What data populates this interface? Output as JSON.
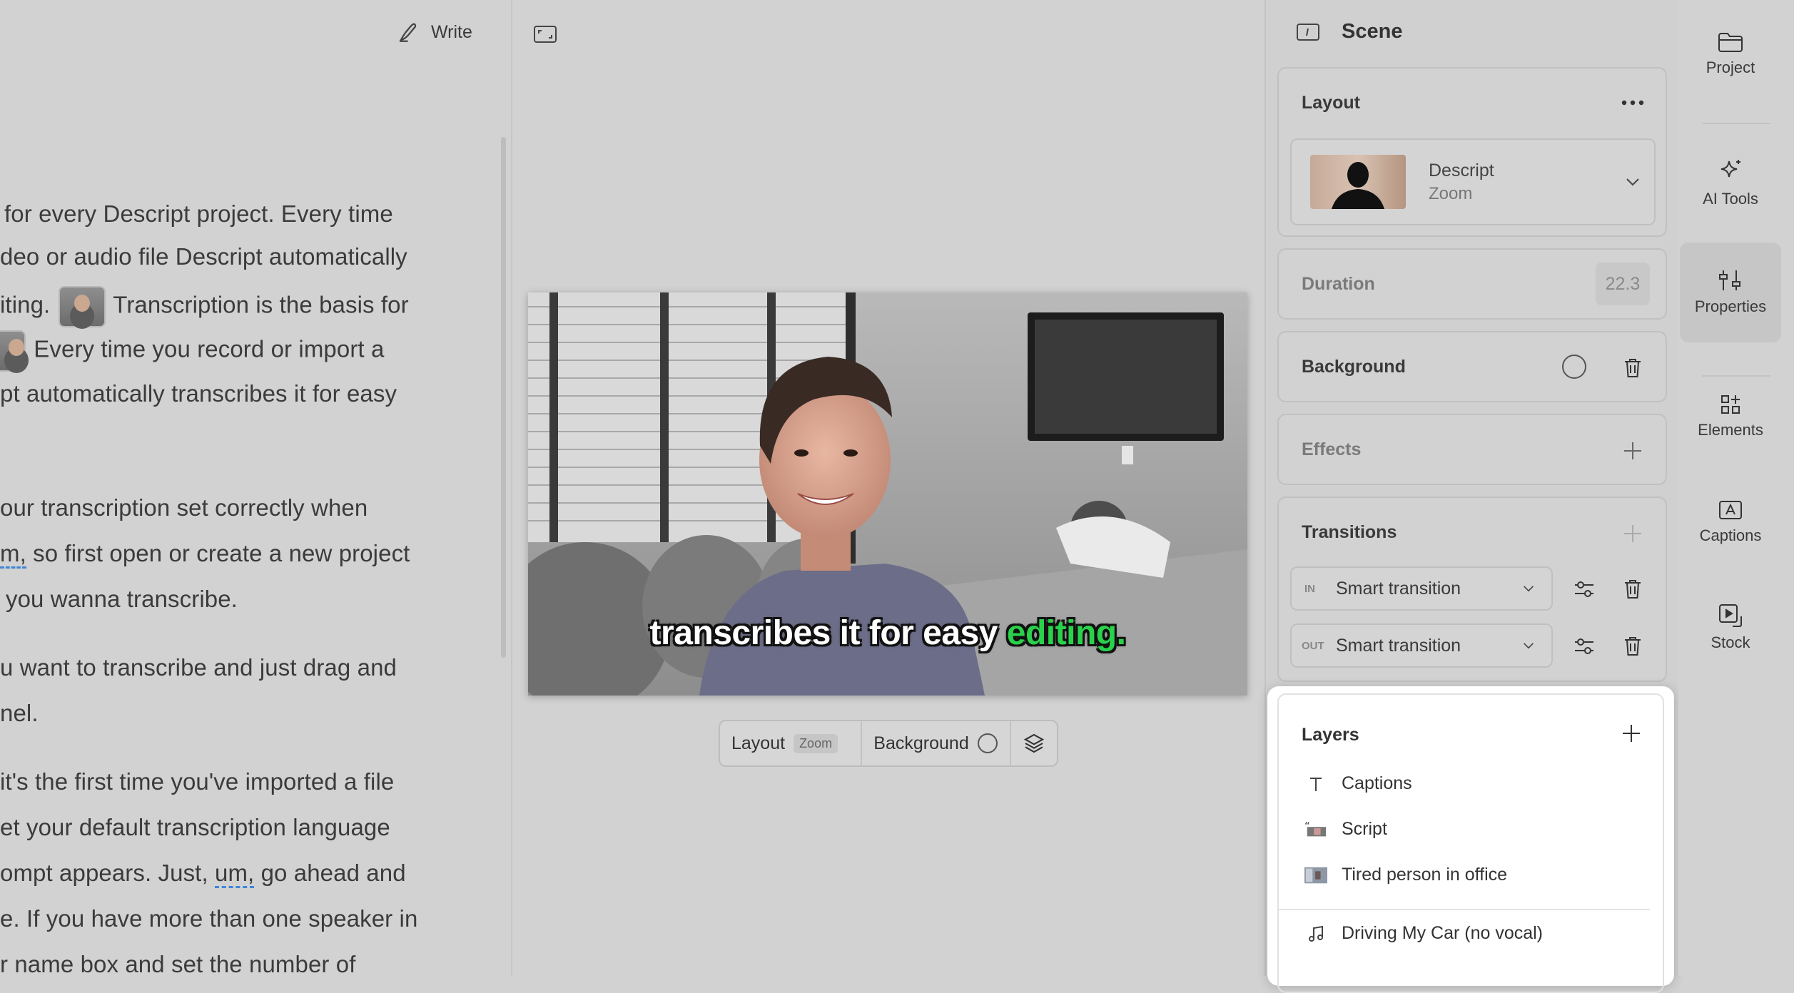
{
  "toolbar": {
    "write_label": "Write"
  },
  "transcript": {
    "lines": [
      "for every Descript project. Every time",
      "deo or audio file Descript automatically",
      "iting.",
      "Transcription is the basis for",
      "Every time you record or import a",
      "pt automatically transcribes it for easy",
      "our transcription set correctly when",
      "m,",
      "so first open or create a new project",
      "you wanna transcribe.",
      "u want to transcribe and just drag and",
      "nel.",
      "it's the first time you've imported a file",
      "et your default transcription language",
      "ompt appears. Just,",
      "um,",
      "go ahead and",
      "e. If you have more than one speaker in",
      "r name box and set the number of"
    ]
  },
  "preview": {
    "caption_before": "transcribes it for easy ",
    "caption_highlight": "editing.",
    "bar": {
      "layout_label": "Layout",
      "layout_tag": "Zoom",
      "background_label": "Background"
    }
  },
  "scene": {
    "title": "Scene",
    "layout": {
      "title": "Layout",
      "name": "Descript",
      "sub": "Zoom"
    },
    "duration": {
      "title": "Duration",
      "value": "22.3"
    },
    "background": {
      "title": "Background"
    },
    "effects": {
      "title": "Effects"
    },
    "transitions": {
      "title": "Transitions",
      "in_tag": "IN",
      "in_value": "Smart transition",
      "out_tag": "OUT",
      "out_value": "Smart transition"
    }
  },
  "layers": {
    "title": "Layers",
    "items": [
      {
        "label": "Captions",
        "icon": "text-icon"
      },
      {
        "label": "Script",
        "icon": "script-thumbnail"
      },
      {
        "label": "Tired person in office",
        "icon": "video-thumbnail"
      },
      {
        "label": "Driving My Car (no vocal)",
        "icon": "music-note-icon"
      }
    ]
  },
  "nav": {
    "items": [
      {
        "label": "Project",
        "icon": "folder-icon"
      },
      {
        "label": "AI Tools",
        "icon": "sparkle-icon"
      },
      {
        "label": "Properties",
        "icon": "sliders-icon"
      },
      {
        "label": "Elements",
        "icon": "elements-icon"
      },
      {
        "label": "Captions",
        "icon": "captions-icon"
      },
      {
        "label": "Stock",
        "icon": "stock-icon"
      }
    ],
    "active": "Properties"
  },
  "colors": {
    "caption_highlight": "#2ad14b",
    "underline": "#3f86d8"
  }
}
